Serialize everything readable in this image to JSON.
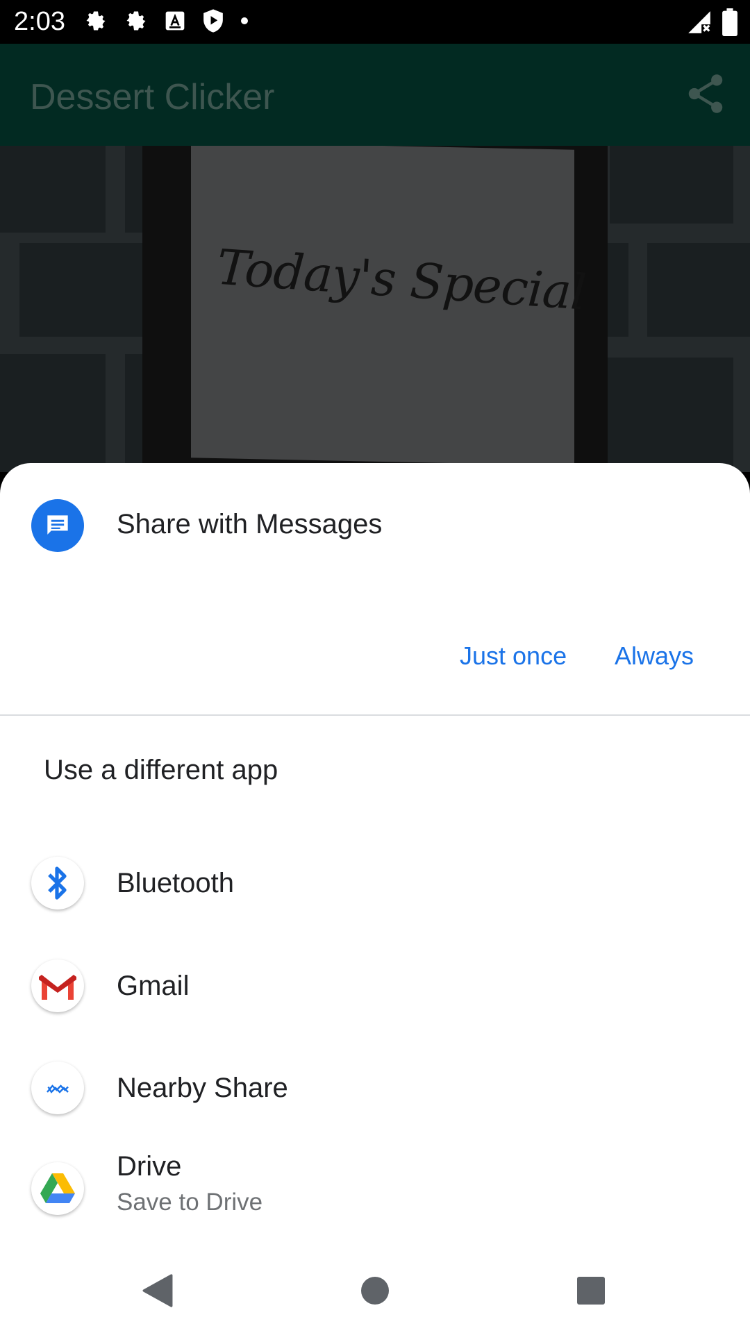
{
  "status_bar": {
    "time": "2:03"
  },
  "app_bar": {
    "title": "Dessert Clicker"
  },
  "hero": {
    "sign_text": "Today's Special"
  },
  "share_sheet": {
    "primary": {
      "title": "Share with Messages"
    },
    "actions": {
      "just_once": "Just once",
      "always": "Always"
    },
    "different_app_label": "Use a different app",
    "apps": [
      {
        "label": "Bluetooth",
        "icon": "bluetooth-icon"
      },
      {
        "label": "Gmail",
        "icon": "gmail-icon"
      },
      {
        "label": "Nearby Share",
        "icon": "nearby-share-icon"
      },
      {
        "label": "Drive",
        "sublabel": "Save to Drive",
        "icon": "drive-icon"
      }
    ]
  },
  "colors": {
    "accent": "#1a73e8",
    "app_bar": "#022a22"
  }
}
